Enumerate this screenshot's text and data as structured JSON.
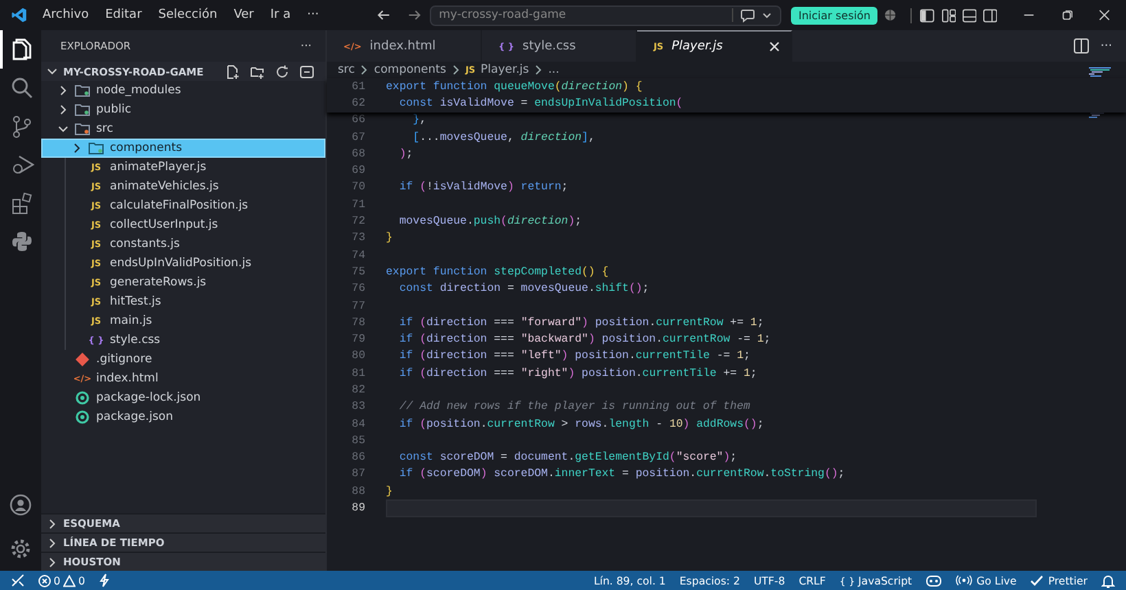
{
  "title_bar": {
    "menus": [
      "Archivo",
      "Editar",
      "Selección",
      "Ver",
      "Ir a",
      "···"
    ],
    "search": {
      "value": "my-crossy-road-game"
    },
    "sign_in": "Iniciar sesión"
  },
  "activity_bar": [
    {
      "kind": "files",
      "selected": true
    },
    {
      "kind": "search",
      "selected": false
    },
    {
      "kind": "source-control",
      "selected": false
    },
    {
      "kind": "run",
      "selected": false
    },
    {
      "kind": "extensions",
      "selected": false
    },
    {
      "kind": "python",
      "selected": false
    }
  ],
  "activity_bottom": [
    {
      "kind": "account"
    },
    {
      "kind": "settings"
    }
  ],
  "explorer": {
    "title": "EXPLORADOR",
    "more": "···",
    "root": {
      "name": "MY-CROSSY-ROAD-GAME",
      "expanded": true,
      "children": [
        {
          "name": "node_modules",
          "kind": "folder",
          "expanded": false,
          "selected": false
        },
        {
          "name": "public",
          "kind": "folder",
          "expanded": false,
          "selected": false
        },
        {
          "name": "src",
          "kind": "folder",
          "expanded": true,
          "selected": false,
          "children": [
            {
              "name": "components",
              "kind": "folder",
              "expanded": false,
              "selected": true
            },
            {
              "name": "animatePlayer.js",
              "kind": "js",
              "icon": "JS",
              "selected": false
            },
            {
              "name": "animateVehicles.js",
              "kind": "js",
              "icon": "JS",
              "selected": false
            },
            {
              "name": "calculateFinalPosition.js",
              "kind": "js",
              "icon": "JS",
              "selected": false
            },
            {
              "name": "collectUserInput.js",
              "kind": "js",
              "icon": "JS",
              "selected": false
            },
            {
              "name": "constants.js",
              "kind": "js",
              "icon": "JS",
              "selected": false
            },
            {
              "name": "endsUpInValidPosition.js",
              "kind": "js",
              "icon": "JS",
              "selected": false
            },
            {
              "name": "generateRows.js",
              "kind": "js",
              "icon": "JS",
              "selected": false
            },
            {
              "name": "hitTest.js",
              "kind": "js",
              "icon": "JS",
              "selected": false
            },
            {
              "name": "main.js",
              "kind": "js",
              "icon": "JS",
              "selected": false
            },
            {
              "name": "style.css",
              "kind": "css",
              "icon": "{ }",
              "selected": false
            }
          ]
        },
        {
          "name": ".gitignore",
          "kind": "git",
          "selected": false
        },
        {
          "name": "index.html",
          "kind": "html",
          "icon": "</>",
          "selected": false
        },
        {
          "name": "package-lock.json",
          "kind": "json",
          "selected": false
        },
        {
          "name": "package.json",
          "kind": "json",
          "selected": false
        }
      ]
    }
  },
  "sections": [
    {
      "label": "ESQUEMA",
      "expanded": false
    },
    {
      "label": "LÍNEA DE TIEMPO",
      "expanded": false
    },
    {
      "label": "HOUSTON",
      "expanded": false
    }
  ],
  "tabs": [
    {
      "label": "index.html",
      "kind": "html",
      "icon": "</>",
      "selected": false
    },
    {
      "label": "style.css",
      "kind": "css",
      "icon": "{ }",
      "selected": false
    },
    {
      "label": "Player.js",
      "kind": "js",
      "icon": "JS",
      "selected": true
    }
  ],
  "tab_more": "···",
  "breadcrumb": [
    {
      "label": "src"
    },
    {
      "label": "components"
    },
    {
      "label": "Player.js",
      "icon": "JS"
    },
    {
      "label": "..."
    }
  ],
  "editor": {
    "sticky_lines": [
      {
        "n": "61",
        "tokens": [
          {
            "kind": "keyword",
            "text": "export "
          },
          {
            "kind": "keyword",
            "text": "function "
          },
          {
            "kind": "function",
            "text": "queueMove"
          },
          {
            "kind": "brace",
            "text": "("
          },
          {
            "kind": "parameter",
            "text": "direction"
          },
          {
            "kind": "brace",
            "text": ") {"
          }
        ]
      },
      {
        "n": "62",
        "tokens": [
          {
            "kind": "keyword",
            "text": "  const "
          },
          {
            "kind": "variable",
            "text": "isValidMove"
          },
          {
            "kind": "operator",
            "text": " = "
          },
          {
            "kind": "function",
            "text": "endsUpInValidPosition"
          },
          {
            "kind": "paren",
            "text": "("
          }
        ]
      }
    ],
    "lines": [
      {
        "n": "66",
        "current": false,
        "tokens": [
          {
            "kind": "bracket",
            "text": "    }"
          },
          {
            "kind": "operator",
            "text": ","
          }
        ]
      },
      {
        "n": "67",
        "current": false,
        "tokens": [
          {
            "kind": "bracket",
            "text": "    ["
          },
          {
            "kind": "operator",
            "text": "..."
          },
          {
            "kind": "variable",
            "text": "movesQueue"
          },
          {
            "kind": "operator",
            "text": ", "
          },
          {
            "kind": "parameter",
            "text": "direction"
          },
          {
            "kind": "bracket",
            "text": "]"
          },
          {
            "kind": "operator",
            "text": ","
          }
        ]
      },
      {
        "n": "68",
        "current": false,
        "tokens": [
          {
            "kind": "paren",
            "text": "  )"
          },
          {
            "kind": "operator",
            "text": ";"
          }
        ]
      },
      {
        "n": "69",
        "current": false
      },
      {
        "n": "70",
        "current": false,
        "tokens": [
          {
            "kind": "keyword",
            "text": "  if "
          },
          {
            "kind": "paren",
            "text": "("
          },
          {
            "kind": "operator",
            "text": "!"
          },
          {
            "kind": "variable",
            "text": "isValidMove"
          },
          {
            "kind": "paren",
            "text": ") "
          },
          {
            "kind": "keyword",
            "text": "return"
          },
          {
            "kind": "operator",
            "text": ";"
          }
        ]
      },
      {
        "n": "71",
        "current": false
      },
      {
        "n": "72",
        "current": false,
        "tokens": [
          {
            "kind": "variable",
            "text": "  movesQueue"
          },
          {
            "kind": "operator",
            "text": "."
          },
          {
            "kind": "function",
            "text": "push"
          },
          {
            "kind": "paren",
            "text": "("
          },
          {
            "kind": "parameter",
            "text": "direction"
          },
          {
            "kind": "paren",
            "text": ")"
          },
          {
            "kind": "operator",
            "text": ";"
          }
        ]
      },
      {
        "n": "73",
        "current": false,
        "tokens": [
          {
            "kind": "brace",
            "text": "}"
          }
        ]
      },
      {
        "n": "74",
        "current": false
      },
      {
        "n": "75",
        "current": false,
        "tokens": [
          {
            "kind": "keyword",
            "text": "export "
          },
          {
            "kind": "keyword",
            "text": "function "
          },
          {
            "kind": "function",
            "text": "stepCompleted"
          },
          {
            "kind": "brace",
            "text": "() {"
          }
        ]
      },
      {
        "n": "76",
        "current": false,
        "tokens": [
          {
            "kind": "keyword",
            "text": "  const "
          },
          {
            "kind": "variable",
            "text": "direction"
          },
          {
            "kind": "operator",
            "text": " = "
          },
          {
            "kind": "variable",
            "text": "movesQueue"
          },
          {
            "kind": "operator",
            "text": "."
          },
          {
            "kind": "function",
            "text": "shift"
          },
          {
            "kind": "paren",
            "text": "()"
          },
          {
            "kind": "operator",
            "text": ";"
          }
        ]
      },
      {
        "n": "77",
        "current": false
      },
      {
        "n": "78",
        "current": false,
        "tokens": [
          {
            "kind": "keyword",
            "text": "  if "
          },
          {
            "kind": "paren",
            "text": "("
          },
          {
            "kind": "variable",
            "text": "direction"
          },
          {
            "kind": "operator",
            "text": " === "
          },
          {
            "kind": "string",
            "text": "\"forward\""
          },
          {
            "kind": "paren",
            "text": ") "
          },
          {
            "kind": "variable",
            "text": "position"
          },
          {
            "kind": "operator",
            "text": "."
          },
          {
            "kind": "property",
            "text": "currentRow"
          },
          {
            "kind": "operator",
            "text": " += "
          },
          {
            "kind": "number",
            "text": "1"
          },
          {
            "kind": "operator",
            "text": ";"
          }
        ]
      },
      {
        "n": "79",
        "current": false,
        "tokens": [
          {
            "kind": "keyword",
            "text": "  if "
          },
          {
            "kind": "paren",
            "text": "("
          },
          {
            "kind": "variable",
            "text": "direction"
          },
          {
            "kind": "operator",
            "text": " === "
          },
          {
            "kind": "string",
            "text": "\"backward\""
          },
          {
            "kind": "paren",
            "text": ") "
          },
          {
            "kind": "variable",
            "text": "position"
          },
          {
            "kind": "operator",
            "text": "."
          },
          {
            "kind": "property",
            "text": "currentRow"
          },
          {
            "kind": "operator",
            "text": " -= "
          },
          {
            "kind": "number",
            "text": "1"
          },
          {
            "kind": "operator",
            "text": ";"
          }
        ]
      },
      {
        "n": "80",
        "current": false,
        "tokens": [
          {
            "kind": "keyword",
            "text": "  if "
          },
          {
            "kind": "paren",
            "text": "("
          },
          {
            "kind": "variable",
            "text": "direction"
          },
          {
            "kind": "operator",
            "text": " === "
          },
          {
            "kind": "string",
            "text": "\"left\""
          },
          {
            "kind": "paren",
            "text": ") "
          },
          {
            "kind": "variable",
            "text": "position"
          },
          {
            "kind": "operator",
            "text": "."
          },
          {
            "kind": "property",
            "text": "currentTile"
          },
          {
            "kind": "operator",
            "text": " -= "
          },
          {
            "kind": "number",
            "text": "1"
          },
          {
            "kind": "operator",
            "text": ";"
          }
        ]
      },
      {
        "n": "81",
        "current": false,
        "tokens": [
          {
            "kind": "keyword",
            "text": "  if "
          },
          {
            "kind": "paren",
            "text": "("
          },
          {
            "kind": "variable",
            "text": "direction"
          },
          {
            "kind": "operator",
            "text": " === "
          },
          {
            "kind": "string",
            "text": "\"right\""
          },
          {
            "kind": "paren",
            "text": ") "
          },
          {
            "kind": "variable",
            "text": "position"
          },
          {
            "kind": "operator",
            "text": "."
          },
          {
            "kind": "property",
            "text": "currentTile"
          },
          {
            "kind": "operator",
            "text": " += "
          },
          {
            "kind": "number",
            "text": "1"
          },
          {
            "kind": "operator",
            "text": ";"
          }
        ]
      },
      {
        "n": "82",
        "current": false
      },
      {
        "n": "83",
        "current": false,
        "tokens": [
          {
            "kind": "comment",
            "text": "  // Add new rows if the player is running out of them"
          }
        ]
      },
      {
        "n": "84",
        "current": false,
        "tokens": [
          {
            "kind": "keyword",
            "text": "  if "
          },
          {
            "kind": "paren",
            "text": "("
          },
          {
            "kind": "variable",
            "text": "position"
          },
          {
            "kind": "operator",
            "text": "."
          },
          {
            "kind": "property",
            "text": "currentRow"
          },
          {
            "kind": "operator",
            "text": " > "
          },
          {
            "kind": "variable",
            "text": "rows"
          },
          {
            "kind": "operator",
            "text": "."
          },
          {
            "kind": "property",
            "text": "length"
          },
          {
            "kind": "operator",
            "text": " - "
          },
          {
            "kind": "number",
            "text": "10"
          },
          {
            "kind": "paren",
            "text": ") "
          },
          {
            "kind": "function",
            "text": "addRows"
          },
          {
            "kind": "paren",
            "text": "()"
          },
          {
            "kind": "operator",
            "text": ";"
          }
        ]
      },
      {
        "n": "85",
        "current": false
      },
      {
        "n": "86",
        "current": false,
        "tokens": [
          {
            "kind": "keyword",
            "text": "  const "
          },
          {
            "kind": "variable",
            "text": "scoreDOM"
          },
          {
            "kind": "operator",
            "text": " = "
          },
          {
            "kind": "variable",
            "text": "document"
          },
          {
            "kind": "operator",
            "text": "."
          },
          {
            "kind": "function",
            "text": "getElementById"
          },
          {
            "kind": "paren",
            "text": "("
          },
          {
            "kind": "string",
            "text": "\"score\""
          },
          {
            "kind": "paren",
            "text": ")"
          },
          {
            "kind": "operator",
            "text": ";"
          }
        ]
      },
      {
        "n": "87",
        "current": false,
        "tokens": [
          {
            "kind": "keyword",
            "text": "  if "
          },
          {
            "kind": "paren",
            "text": "("
          },
          {
            "kind": "variable",
            "text": "scoreDOM"
          },
          {
            "kind": "paren",
            "text": ") "
          },
          {
            "kind": "variable",
            "text": "scoreDOM"
          },
          {
            "kind": "operator",
            "text": "."
          },
          {
            "kind": "property",
            "text": "innerText"
          },
          {
            "kind": "operator",
            "text": " = "
          },
          {
            "kind": "variable",
            "text": "position"
          },
          {
            "kind": "operator",
            "text": "."
          },
          {
            "kind": "property",
            "text": "currentRow"
          },
          {
            "kind": "operator",
            "text": "."
          },
          {
            "kind": "function",
            "text": "toString"
          },
          {
            "kind": "paren",
            "text": "()"
          },
          {
            "kind": "operator",
            "text": ";"
          }
        ]
      },
      {
        "n": "88",
        "current": false,
        "tokens": [
          {
            "kind": "brace",
            "text": "}"
          }
        ]
      },
      {
        "n": "89",
        "current": true
      }
    ]
  },
  "status_bar": {
    "errors": "0",
    "warnings": "0",
    "items": [
      {
        "kind": "text",
        "text": "Lín. 89, col. 1"
      },
      {
        "kind": "text",
        "text": "Espacios: 2"
      },
      {
        "kind": "text",
        "text": "UTF-8"
      },
      {
        "kind": "text",
        "text": "CRLF"
      },
      {
        "kind": "language",
        "icon": "{ }",
        "text": "JavaScript"
      },
      {
        "kind": "copilot"
      },
      {
        "kind": "golive",
        "text": "Go Live"
      },
      {
        "kind": "prettier",
        "text": "Prettier"
      },
      {
        "kind": "bell"
      }
    ]
  }
}
